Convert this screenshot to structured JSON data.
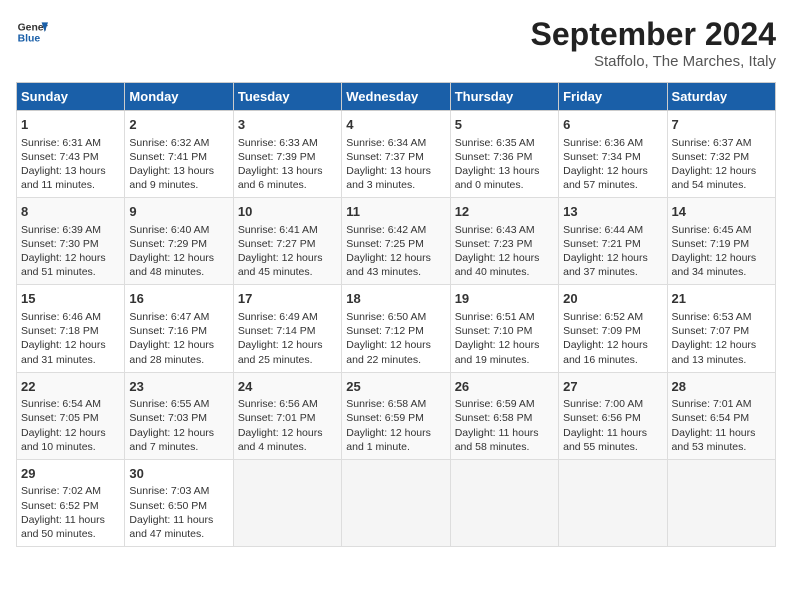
{
  "header": {
    "logo_general": "General",
    "logo_blue": "Blue",
    "title": "September 2024",
    "subtitle": "Staffolo, The Marches, Italy"
  },
  "days_of_week": [
    "Sunday",
    "Monday",
    "Tuesday",
    "Wednesday",
    "Thursday",
    "Friday",
    "Saturday"
  ],
  "weeks": [
    [
      {
        "day": "1",
        "sunrise": "6:31 AM",
        "sunset": "7:43 PM",
        "daylight": "13 hours and 11 minutes."
      },
      {
        "day": "2",
        "sunrise": "6:32 AM",
        "sunset": "7:41 PM",
        "daylight": "13 hours and 9 minutes."
      },
      {
        "day": "3",
        "sunrise": "6:33 AM",
        "sunset": "7:39 PM",
        "daylight": "13 hours and 6 minutes."
      },
      {
        "day": "4",
        "sunrise": "6:34 AM",
        "sunset": "7:37 PM",
        "daylight": "13 hours and 3 minutes."
      },
      {
        "day": "5",
        "sunrise": "6:35 AM",
        "sunset": "7:36 PM",
        "daylight": "13 hours and 0 minutes."
      },
      {
        "day": "6",
        "sunrise": "6:36 AM",
        "sunset": "7:34 PM",
        "daylight": "12 hours and 57 minutes."
      },
      {
        "day": "7",
        "sunrise": "6:37 AM",
        "sunset": "7:32 PM",
        "daylight": "12 hours and 54 minutes."
      }
    ],
    [
      {
        "day": "8",
        "sunrise": "6:39 AM",
        "sunset": "7:30 PM",
        "daylight": "12 hours and 51 minutes."
      },
      {
        "day": "9",
        "sunrise": "6:40 AM",
        "sunset": "7:29 PM",
        "daylight": "12 hours and 48 minutes."
      },
      {
        "day": "10",
        "sunrise": "6:41 AM",
        "sunset": "7:27 PM",
        "daylight": "12 hours and 45 minutes."
      },
      {
        "day": "11",
        "sunrise": "6:42 AM",
        "sunset": "7:25 PM",
        "daylight": "12 hours and 43 minutes."
      },
      {
        "day": "12",
        "sunrise": "6:43 AM",
        "sunset": "7:23 PM",
        "daylight": "12 hours and 40 minutes."
      },
      {
        "day": "13",
        "sunrise": "6:44 AM",
        "sunset": "7:21 PM",
        "daylight": "12 hours and 37 minutes."
      },
      {
        "day": "14",
        "sunrise": "6:45 AM",
        "sunset": "7:19 PM",
        "daylight": "12 hours and 34 minutes."
      }
    ],
    [
      {
        "day": "15",
        "sunrise": "6:46 AM",
        "sunset": "7:18 PM",
        "daylight": "12 hours and 31 minutes."
      },
      {
        "day": "16",
        "sunrise": "6:47 AM",
        "sunset": "7:16 PM",
        "daylight": "12 hours and 28 minutes."
      },
      {
        "day": "17",
        "sunrise": "6:49 AM",
        "sunset": "7:14 PM",
        "daylight": "12 hours and 25 minutes."
      },
      {
        "day": "18",
        "sunrise": "6:50 AM",
        "sunset": "7:12 PM",
        "daylight": "12 hours and 22 minutes."
      },
      {
        "day": "19",
        "sunrise": "6:51 AM",
        "sunset": "7:10 PM",
        "daylight": "12 hours and 19 minutes."
      },
      {
        "day": "20",
        "sunrise": "6:52 AM",
        "sunset": "7:09 PM",
        "daylight": "12 hours and 16 minutes."
      },
      {
        "day": "21",
        "sunrise": "6:53 AM",
        "sunset": "7:07 PM",
        "daylight": "12 hours and 13 minutes."
      }
    ],
    [
      {
        "day": "22",
        "sunrise": "6:54 AM",
        "sunset": "7:05 PM",
        "daylight": "12 hours and 10 minutes."
      },
      {
        "day": "23",
        "sunrise": "6:55 AM",
        "sunset": "7:03 PM",
        "daylight": "12 hours and 7 minutes."
      },
      {
        "day": "24",
        "sunrise": "6:56 AM",
        "sunset": "7:01 PM",
        "daylight": "12 hours and 4 minutes."
      },
      {
        "day": "25",
        "sunrise": "6:58 AM",
        "sunset": "6:59 PM",
        "daylight": "12 hours and 1 minute."
      },
      {
        "day": "26",
        "sunrise": "6:59 AM",
        "sunset": "6:58 PM",
        "daylight": "11 hours and 58 minutes."
      },
      {
        "day": "27",
        "sunrise": "7:00 AM",
        "sunset": "6:56 PM",
        "daylight": "11 hours and 55 minutes."
      },
      {
        "day": "28",
        "sunrise": "7:01 AM",
        "sunset": "6:54 PM",
        "daylight": "11 hours and 53 minutes."
      }
    ],
    [
      {
        "day": "29",
        "sunrise": "7:02 AM",
        "sunset": "6:52 PM",
        "daylight": "11 hours and 50 minutes."
      },
      {
        "day": "30",
        "sunrise": "7:03 AM",
        "sunset": "6:50 PM",
        "daylight": "11 hours and 47 minutes."
      },
      null,
      null,
      null,
      null,
      null
    ]
  ]
}
